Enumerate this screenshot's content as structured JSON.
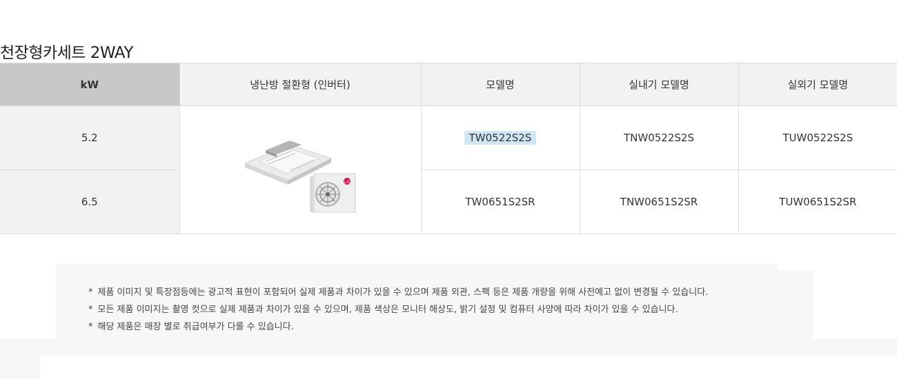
{
  "page_title": "천장형카세트 2WAY",
  "table": {
    "headers": [
      "kW",
      "냉난방 절환형 (인버터)",
      "모델명",
      "실내기 모델명",
      "실외기 모델명"
    ],
    "rows": [
      {
        "kw": "5.2",
        "model": "TW0522S2S",
        "indoor": "TNW0522S2S",
        "outdoor": "TUW0522S2S"
      },
      {
        "kw": "6.5",
        "model": "TW0651S2SR",
        "indoor": "TNW0651S2SR",
        "outdoor": "TUW0651S2SR"
      }
    ],
    "product_image_badge": "LG"
  },
  "notices": [
    "제품 이미지 및 특장점등에는 광고적 표현이 포함되어 실제 제품과 차이가 있을 수 있으며 제품 외관, 스펙 등은 제품 개량을 위해 사전예고 없이 변경될 수 있습니다.",
    "모든 제품 이미지는 촬영 컷으로 실제 제품과 차이가 있을 수 있으며, 제품 색상은 모니터 해상도, 밝기 설정 및 컴퓨터 사양에 따라 차이가 있을 수 있습니다.",
    "해당 제품은 매장 별로 취급여부가 다를 수 있습니다."
  ],
  "notice_bullet": "*",
  "colors": {
    "kw_header_bg": "#c8c8c8",
    "header_bg": "#f2f2f2",
    "highlight_bg": "#cfe6f5",
    "notice_bg": "#f7f7f7"
  }
}
